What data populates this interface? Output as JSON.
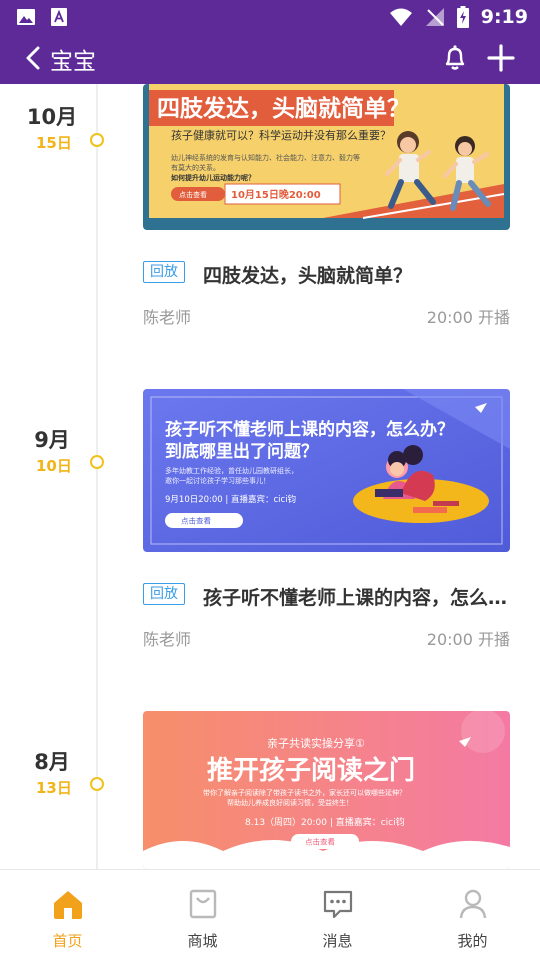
{
  "status_bar": {
    "time": "9:19"
  },
  "header": {
    "title": "宝宝"
  },
  "items": [
    {
      "month": "10月",
      "day": "15日",
      "replay": "回放",
      "title": "四肢发达，头脑就简单？",
      "teacher": "陈老师",
      "time": "20:00 开播",
      "banner": {
        "headline": "四肢发达，头脑就简单？",
        "sub": "孩子健康就可以？科学运动并没有那么重要？",
        "body": [
          "幼儿神经系统的发育与认知能力、社会能力、注意力、毅力等",
          "有莫大的关系。",
          "如何提升幼儿运动能力呢？"
        ],
        "btn": "点击查看",
        "date": "10月15日晚20:00"
      }
    },
    {
      "month": "9月",
      "day": "10日",
      "replay": "回放",
      "title": "孩子听不懂老师上课的内容，怎么办？到底哪里出了问题？",
      "teacher": "陈老师",
      "time": "20:00 开播",
      "banner": {
        "headline1": "孩子听不懂老师上课的内容，怎么办？",
        "headline2": "到底哪里出了问题？",
        "body": [
          "多年幼教工作经验，曾任幼儿园教研组长，",
          "邀你一起讨论孩子学习那些事儿！"
        ],
        "date": "9月10日20:00 | 直播嘉宾：cici钧",
        "btn": "点击查看"
      }
    },
    {
      "month": "8月",
      "day": "13日",
      "banner": {
        "top": "亲子共读实操分享①",
        "headline": "推开孩子阅读之门",
        "body": [
          "带你了解亲子阅读除了带孩子读书之外，家长还可以做哪些延伸？",
          "帮助幼儿养成良好阅读习惯，受益终生！"
        ],
        "date": "8.13（周四）20:00 | 直播嘉宾：cici钧",
        "btn": "点击查看"
      }
    }
  ],
  "nav": [
    {
      "label": "首页",
      "icon": "home-icon",
      "active": true
    },
    {
      "label": "商城",
      "icon": "shop-icon"
    },
    {
      "label": "消息",
      "icon": "message-icon"
    },
    {
      "label": "我的",
      "icon": "profile-icon"
    }
  ],
  "colors": {
    "header": "#5d2a98",
    "accent": "#f2a11a",
    "replay": "#3a9ee8"
  }
}
